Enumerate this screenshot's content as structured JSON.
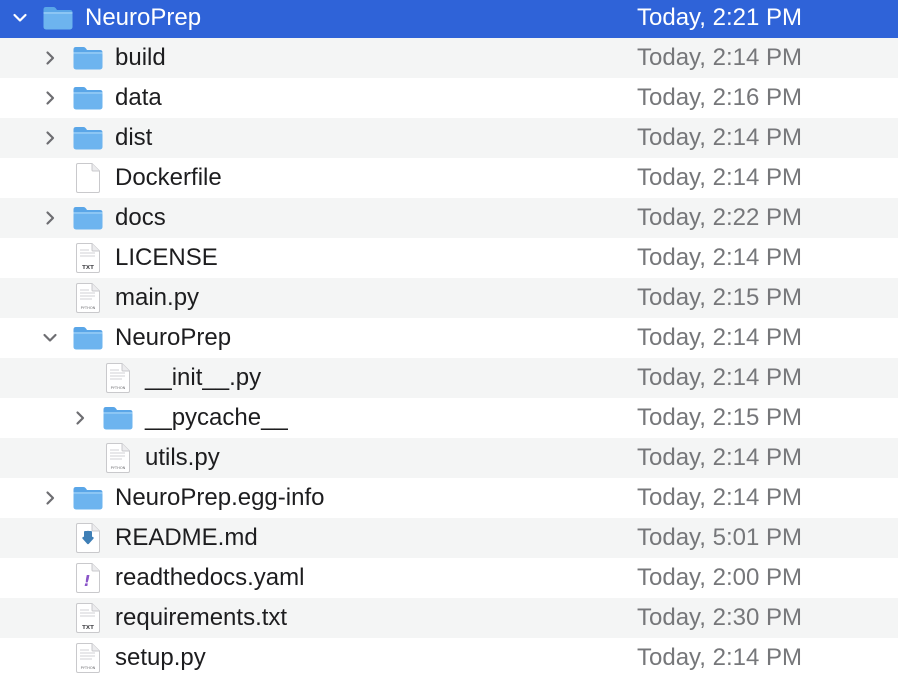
{
  "colors": {
    "selection": "#2f63d8",
    "folder_body": "#6db4ef",
    "folder_tab": "#5aa6e8",
    "stripe": "#f4f5f5",
    "date_text": "#76777a"
  },
  "rows": [
    {
      "name": "NeuroPrep",
      "date": "Today, 2:21 PM",
      "kind": "folder",
      "depth": 0,
      "disclosure": "expanded",
      "selected": true
    },
    {
      "name": "build",
      "date": "Today, 2:14 PM",
      "kind": "folder",
      "depth": 1,
      "disclosure": "collapsed"
    },
    {
      "name": "data",
      "date": "Today, 2:16 PM",
      "kind": "folder",
      "depth": 1,
      "disclosure": "collapsed"
    },
    {
      "name": "dist",
      "date": "Today, 2:14 PM",
      "kind": "folder",
      "depth": 1,
      "disclosure": "collapsed"
    },
    {
      "name": "Dockerfile",
      "date": "Today, 2:14 PM",
      "kind": "file-blank",
      "depth": 1,
      "disclosure": "none"
    },
    {
      "name": "docs",
      "date": "Today, 2:22 PM",
      "kind": "folder",
      "depth": 1,
      "disclosure": "collapsed"
    },
    {
      "name": "LICENSE",
      "date": "Today, 2:14 PM",
      "kind": "file-txt",
      "depth": 1,
      "disclosure": "none",
      "badge": "TXT"
    },
    {
      "name": "main.py",
      "date": "Today, 2:15 PM",
      "kind": "file-python",
      "depth": 1,
      "disclosure": "none",
      "badge": "PYTHON"
    },
    {
      "name": "NeuroPrep",
      "date": "Today, 2:14 PM",
      "kind": "folder",
      "depth": 1,
      "disclosure": "expanded"
    },
    {
      "name": "__init__.py",
      "date": "Today, 2:14 PM",
      "kind": "file-python",
      "depth": 2,
      "disclosure": "none",
      "badge": "PYTHON"
    },
    {
      "name": "__pycache__",
      "date": "Today, 2:15 PM",
      "kind": "folder",
      "depth": 2,
      "disclosure": "collapsed"
    },
    {
      "name": "utils.py",
      "date": "Today, 2:14 PM",
      "kind": "file-python",
      "depth": 2,
      "disclosure": "none",
      "badge": "PYTHON"
    },
    {
      "name": "NeuroPrep.egg-info",
      "date": "Today, 2:14 PM",
      "kind": "folder",
      "depth": 1,
      "disclosure": "collapsed"
    },
    {
      "name": "README.md",
      "date": "Today, 5:01 PM",
      "kind": "file-markdown",
      "depth": 1,
      "disclosure": "none"
    },
    {
      "name": "readthedocs.yaml",
      "date": "Today, 2:00 PM",
      "kind": "file-yaml",
      "depth": 1,
      "disclosure": "none",
      "badge": "!"
    },
    {
      "name": "requirements.txt",
      "date": "Today, 2:30 PM",
      "kind": "file-txt",
      "depth": 1,
      "disclosure": "none",
      "badge": "TXT"
    },
    {
      "name": "setup.py",
      "date": "Today, 2:14 PM",
      "kind": "file-python",
      "depth": 1,
      "disclosure": "none",
      "badge": "PYTHON"
    }
  ]
}
